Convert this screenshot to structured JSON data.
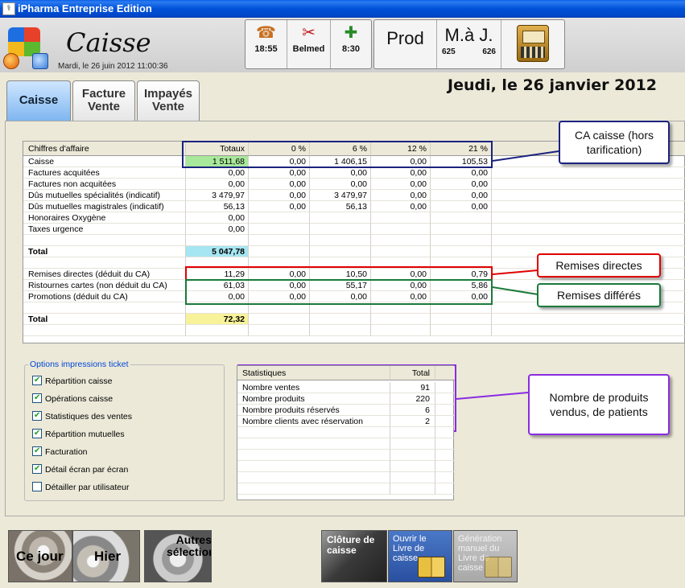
{
  "window": {
    "title": "iPharma Entreprise Edition"
  },
  "header": {
    "page_title": "Caisse",
    "date_time": "Mardi, le 26 juin 2012  11:00:36",
    "big_date": "Jeudi, le 26 janvier 2012",
    "quick_buttons": [
      {
        "label": "18:55",
        "icon": "phone-icon"
      },
      {
        "label": "Belmed",
        "icon": "tools-icon"
      },
      {
        "label": "8:30",
        "icon": "ambulance-icon"
      }
    ],
    "prod_label": "Prod",
    "maj_label": "M.à J.",
    "maj_counts": [
      "625",
      "626"
    ],
    "register_icon": "cash-register-icon"
  },
  "tabs": [
    {
      "label": "Caisse",
      "active": true
    },
    {
      "label": "Facture Vente",
      "active": false
    },
    {
      "label": "Impayés Vente",
      "active": false
    }
  ],
  "grid": {
    "headers": [
      "Chiffres d'affaire",
      "Totaux",
      "0 %",
      "6 %",
      "12 %",
      "21 %"
    ],
    "rows": [
      {
        "label": "Caisse",
        "values": [
          "1 511,68",
          "0,00",
          "1 406,15",
          "0,00",
          "105,53"
        ]
      },
      {
        "label": "Factures acquitées",
        "values": [
          "0,00",
          "0,00",
          "0,00",
          "0,00",
          "0,00"
        ]
      },
      {
        "label": "Factures non acquitées",
        "values": [
          "0,00",
          "0,00",
          "0,00",
          "0,00",
          "0,00"
        ]
      },
      {
        "label": "Dûs mutuelles spécialités (indicatif)",
        "values": [
          "3 479,97",
          "0,00",
          "3 479,97",
          "0,00",
          "0,00"
        ]
      },
      {
        "label": "Dûs mutuelles magistrales (indicatif)",
        "values": [
          "56,13",
          "0,00",
          "56,13",
          "0,00",
          "0,00"
        ]
      },
      {
        "label": "Honoraires Oxygène",
        "values": [
          "0,00",
          "",
          "",
          "",
          ""
        ]
      },
      {
        "label": "Taxes urgence",
        "values": [
          "0,00",
          "",
          "",
          "",
          ""
        ]
      },
      {
        "label": "",
        "values": [
          "",
          "",
          "",
          "",
          ""
        ]
      },
      {
        "label": "Total",
        "values": [
          "5 047,78",
          "",
          "",
          "",
          ""
        ]
      },
      {
        "label": "",
        "values": [
          "",
          "",
          "",
          "",
          ""
        ]
      },
      {
        "label": "Remises directes (déduit du CA)",
        "values": [
          "11,29",
          "0,00",
          "10,50",
          "0,00",
          "0,79"
        ]
      },
      {
        "label": "Ristournes cartes (non déduit du CA)",
        "values": [
          "61,03",
          "0,00",
          "55,17",
          "0,00",
          "5,86"
        ]
      },
      {
        "label": "Promotions (déduit du CA)",
        "values": [
          "0,00",
          "0,00",
          "0,00",
          "0,00",
          "0,00"
        ]
      },
      {
        "label": "",
        "values": [
          "",
          "",
          "",
          "",
          ""
        ]
      },
      {
        "label": "Total",
        "values": [
          "72,32",
          "",
          "",
          "",
          ""
        ]
      },
      {
        "label": "",
        "values": [
          "",
          "",
          "",
          "",
          ""
        ]
      }
    ],
    "highlight_colors": {
      "caisse": "#a8e89a",
      "total1": "#a6e6f2",
      "total2": "#f8f29a"
    }
  },
  "callouts": {
    "ca_caisse": "CA caisse (hors tarification)",
    "remises_directes": "Remises directes",
    "remises_differes": "Remises différés",
    "nombre_produits": "Nombre de produits vendus, de patients"
  },
  "callout_colors": {
    "blue": "#1a237e",
    "red": "#e00000",
    "green": "#1a7a3a",
    "purple": "#8a2be2"
  },
  "options": {
    "legend": "Options impressions ticket",
    "items": [
      {
        "label": "Répartition caisse",
        "checked": true
      },
      {
        "label": "Opérations caisse",
        "checked": true
      },
      {
        "label": "Statistiques des ventes",
        "checked": true
      },
      {
        "label": "Répartition mutuelles",
        "checked": true
      },
      {
        "label": "Facturation",
        "checked": true
      },
      {
        "label": "Détail écran par écran",
        "checked": true
      },
      {
        "label": "Détailler par utilisateur",
        "checked": false
      }
    ]
  },
  "stats": {
    "headers": [
      "Statistiques",
      "Total"
    ],
    "rows": [
      {
        "label": "Nombre ventes",
        "value": "91"
      },
      {
        "label": "Nombre produits",
        "value": "220"
      },
      {
        "label": "Nombre produits réservés",
        "value": "6"
      },
      {
        "label": "Nombre clients avec réservation",
        "value": "2"
      }
    ]
  },
  "bottom_buttons": {
    "ce_jour": "Ce jour",
    "hier": "Hier",
    "autres": "Autres sélections",
    "cloture": "Clôture de caisse",
    "livre": "Ouvrir le Livre de caisse",
    "generation": "Génération manuel du Livre de caisse"
  }
}
